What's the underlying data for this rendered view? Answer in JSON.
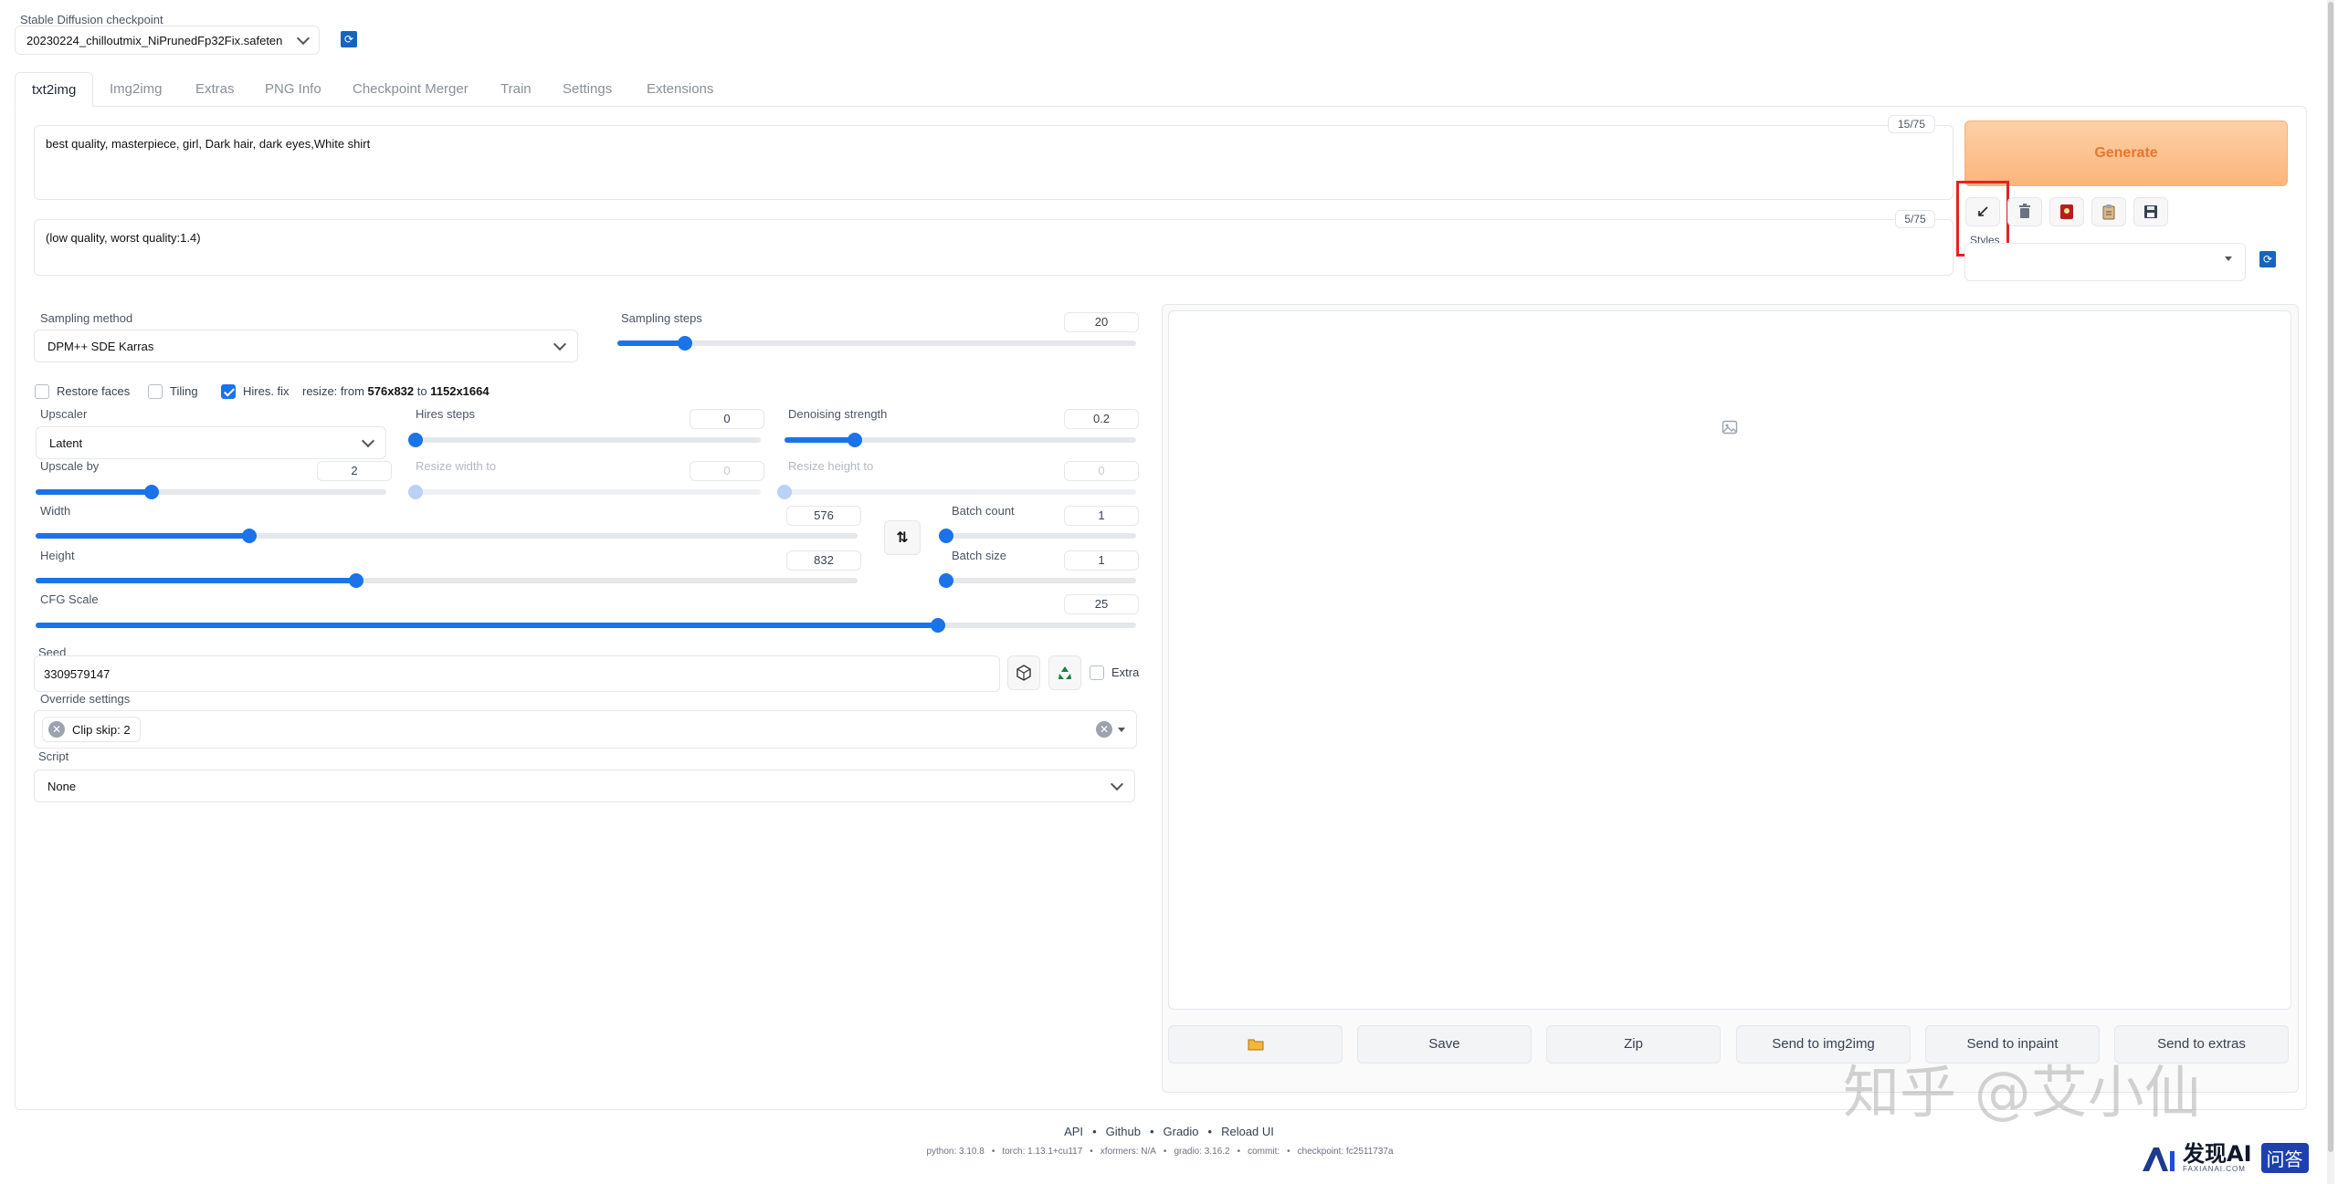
{
  "checkpoint": {
    "label": "Stable Diffusion checkpoint",
    "value": "20230224_chilloutmix_NiPrunedFp32Fix.safeten"
  },
  "tabs": [
    "txt2img",
    "Img2img",
    "Extras",
    "PNG Info",
    "Checkpoint Merger",
    "Train",
    "Settings",
    "Extensions"
  ],
  "prompt": {
    "positive": "best quality, masterpiece, girl, Dark hair, dark eyes,White shirt",
    "positive_count": "15/75",
    "negative": "(low quality, worst quality:1.4)",
    "negative_count": "5/75"
  },
  "generate_label": "Generate",
  "styles_label": "Styles",
  "tool_icons": [
    "arrow-icon",
    "trash-icon",
    "card-icon",
    "clipboard-icon",
    "save-icon"
  ],
  "sampling": {
    "method_label": "Sampling method",
    "method_value": "DPM++ SDE Karras",
    "steps_label": "Sampling steps",
    "steps_value": "20",
    "steps_fraction": 0.13
  },
  "options": {
    "restore_faces": "Restore faces",
    "tiling": "Tiling",
    "hires_fix": "Hires. fix",
    "resize_prefix": "resize: from",
    "resize_from": "576x832",
    "resize_to_word": "to",
    "resize_to": "1152x1664"
  },
  "hires": {
    "upscaler_label": "Upscaler",
    "upscaler_value": "Latent",
    "hires_steps_label": "Hires steps",
    "hires_steps_value": "0",
    "denoising_label": "Denoising strength",
    "denoising_value": "0.2",
    "denoising_fraction": 0.2,
    "upscale_by_label": "Upscale by",
    "upscale_by_value": "2",
    "upscale_by_fraction": 0.33,
    "resize_width_label": "Resize width to",
    "resize_width_value": "0",
    "resize_height_label": "Resize height to",
    "resize_height_value": "0"
  },
  "dimensions": {
    "width_label": "Width",
    "width_value": "576",
    "width_fraction": 0.26,
    "height_label": "Height",
    "height_value": "832",
    "height_fraction": 0.39,
    "batch_count_label": "Batch count",
    "batch_count_value": "1",
    "batch_size_label": "Batch size",
    "batch_size_value": "1"
  },
  "cfg": {
    "label": "CFG Scale",
    "value": "25",
    "fraction": 0.82
  },
  "seed": {
    "label": "Seed",
    "value": "3309579147",
    "extra_label": "Extra"
  },
  "override": {
    "label": "Override settings",
    "chip": "Clip skip: 2"
  },
  "script": {
    "label": "Script",
    "value": "None"
  },
  "output_buttons": [
    "Save",
    "Zip",
    "Send to img2img",
    "Send to inpaint",
    "Send to extras"
  ],
  "footer": {
    "links": [
      "API",
      "Github",
      "Gradio",
      "Reload UI"
    ],
    "versions": [
      "python: 3.10.8",
      "torch: 1.13.1+cu117",
      "xformers: N/A",
      "gradio: 3.16.2",
      "commit:",
      "checkpoint: fc2511737a"
    ]
  },
  "watermark": {
    "text": "知乎 @艾小仙",
    "brand": "发现AI",
    "brand_sub": "FAXIANAI.COM",
    "badge": "问答"
  },
  "colors": {
    "accent": "#1a73e8",
    "generate_bg": "#fdbf8a",
    "generate_text": "#e8762c",
    "highlight": "#e02424"
  }
}
